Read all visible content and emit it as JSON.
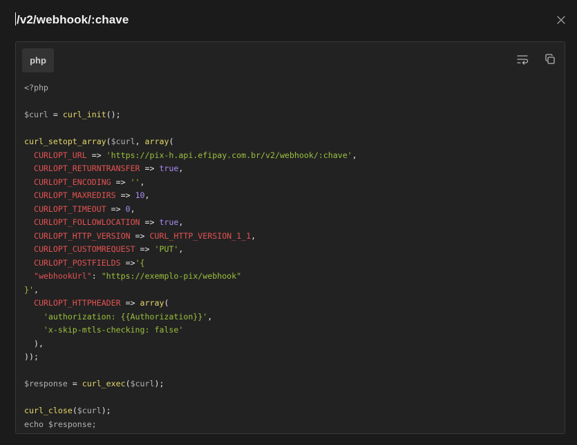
{
  "modal": {
    "title": "/v2/webhook/:chave"
  },
  "code_panel": {
    "language_tab": "php",
    "lines": {
      "l1": "<?php",
      "l3_var": "$curl",
      "l3_eq": " = ",
      "l3_fn": "curl_init",
      "l3_end": "();",
      "l5_fn": "curl_setopt_array",
      "l5_open": "(",
      "l5_var": "$curl",
      "l5_comma": ", ",
      "l5_arr": "array",
      "l5_paren": "(",
      "url_key": "CURLOPT_URL",
      "url_arrow": " => ",
      "url_val": "'https://pix-h.api.efipay.com.br/v2/webhook/:chave'",
      "rt_key": "CURLOPT_RETURNTRANSFER",
      "rt_val": "true",
      "enc_key": "CURLOPT_ENCODING",
      "enc_val": "''",
      "mr_key": "CURLOPT_MAXREDIRS",
      "mr_val": "10",
      "to_key": "CURLOPT_TIMEOUT",
      "to_val": "0",
      "fl_key": "CURLOPT_FOLLOWLOCATION",
      "fl_val": "true",
      "hv_key": "CURLOPT_HTTP_VERSION",
      "hv_val": "CURL_HTTP_VERSION_1_1",
      "cr_key": "CURLOPT_CUSTOMREQUEST",
      "cr_val": "'PUT'",
      "pf_key": "CURLOPT_POSTFIELDS",
      "pf_arrow": " =>",
      "pf_open": "'{",
      "body_key": "\"webhookUrl\"",
      "body_colon": ": ",
      "body_val": "\"https://exemplo-pix/webhook\"",
      "pf_close": "}'",
      "pf_close_comma": ",",
      "hh_key": "CURLOPT_HTTPHEADER",
      "hh_arr": "array",
      "hh_paren": "(",
      "h1": "'authorization: {{Authorization}}'",
      "h2": "'x-skip-mtls-checking: false'",
      "arr_close": "),",
      "call_close": "));",
      "resp_var": "$response",
      "resp_fn": "curl_exec",
      "resp_arg": "$curl",
      "close_fn": "curl_close",
      "close_arg": "$curl",
      "echo_line": "echo $response;"
    }
  },
  "icons": {
    "close": "close-icon",
    "wrap": "word-wrap-icon",
    "copy": "copy-icon"
  }
}
